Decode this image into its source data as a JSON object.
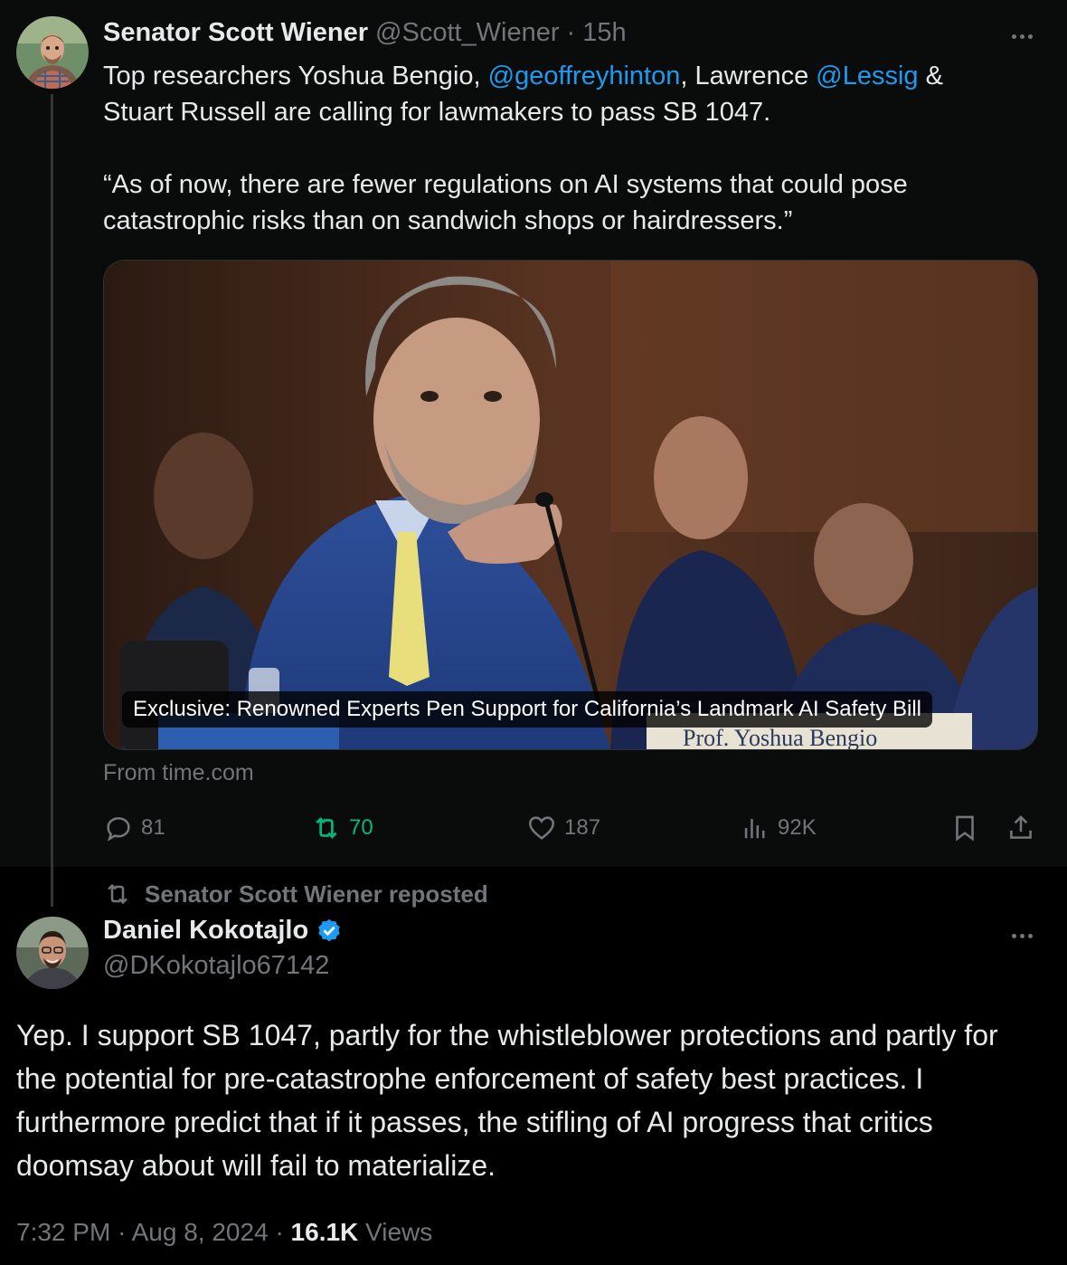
{
  "quoted_tweet": {
    "author_name": "Senator Scott Wiener",
    "handle": "@Scott_Wiener",
    "time": "15h",
    "text_line1_pre": "Top researchers Yoshua Bengio,",
    "mention1": "@geoffreyhinton",
    "text_line1_mid": ", Lawrence",
    "mention2": "@Lessig",
    "text_line1_post": "&",
    "text_line2": "Stuart Russell are calling for lawmakers to pass SB 1047.",
    "quote_line1": "“As of now, there are fewer regulations on AI systems that could pose",
    "quote_line2": "catastrophic risks than on sandwich shops or hairdressers.”",
    "media_caption": "Exclusive: Renowned Experts Pen Support for California’s Landmark AI Safety Bill",
    "nameplate_text": "Prof. Yoshua Bengio",
    "source": "From time.com",
    "replies": "81",
    "reposts": "70",
    "likes": "187",
    "views": "92K"
  },
  "repost_banner": "Senator Scott Wiener reposted",
  "main_tweet": {
    "author_name": "Daniel Kokotajlo",
    "handle": "@DKokotajlo67142",
    "text": "Yep. I support SB 1047, partly for the whistleblower protections and partly for the potential for pre-catastrophe enforcement of safety best practices. I furthermore predict that if it passes, the stifling of AI progress that critics doomsay about will fail to materialize.",
    "time": "7:32 PM",
    "date": "Aug 8, 2024",
    "views_count": "16.1K",
    "views_label": "Views"
  },
  "colors": {
    "accent": "#1d9bf0",
    "repost_active": "#00ba7c",
    "muted": "#71767b"
  },
  "icons": [
    "reply-icon",
    "repost-icon",
    "like-icon",
    "views-icon",
    "bookmark-icon",
    "share-icon",
    "more-icon",
    "verified-badge-icon"
  ]
}
